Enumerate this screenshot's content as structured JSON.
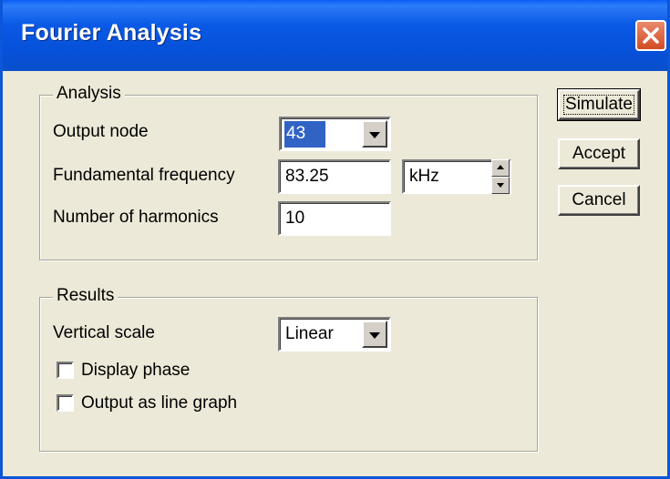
{
  "window": {
    "title": "Fourier Analysis"
  },
  "analysis": {
    "legend": "Analysis",
    "output_node_label": "Output node",
    "output_node_value": "43",
    "fundamental_frequency_label": "Fundamental frequency",
    "fundamental_frequency_value": "83.25",
    "frequency_unit": "kHz",
    "harmonics_label": "Number of harmonics",
    "harmonics_value": "10"
  },
  "results": {
    "legend": "Results",
    "vertical_scale_label": "Vertical scale",
    "vertical_scale_value": "Linear",
    "display_phase_label": "Display phase",
    "display_phase_checked": false,
    "line_graph_label": "Output as line graph",
    "line_graph_checked": false
  },
  "buttons": {
    "simulate": "Simulate",
    "accept": "Accept",
    "cancel": "Cancel"
  },
  "colors": {
    "titlebar": "#0a59e6",
    "dialog_bg": "#ece9d8",
    "selection": "#3163c5",
    "close": "#d24c24"
  }
}
